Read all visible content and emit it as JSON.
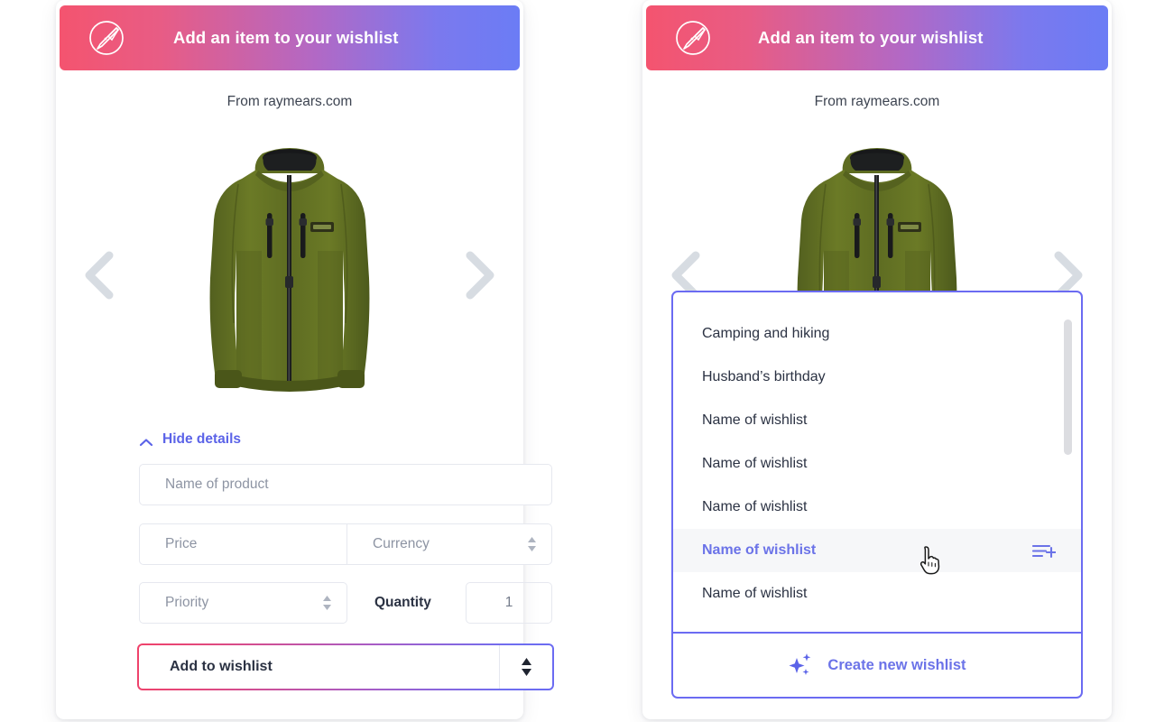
{
  "brand": {
    "gradient_start": "#f4546f",
    "gradient_end": "#6b7cf5",
    "accent_purple": "#6b6bf2",
    "text_dark": "#2b3243",
    "placeholder": "#8d94a3"
  },
  "header": {
    "title": "Add an item to your wishlist",
    "logo_icon": "compass-logo-icon"
  },
  "source": {
    "label": "From raymears.com"
  },
  "carousel": {
    "prev_icon": "chevron-left-icon",
    "next_icon": "chevron-right-icon",
    "product_alt": "olive-green-hooded-fleece-jacket"
  },
  "details": {
    "toggle_label": "Hide details",
    "toggle_icon": "chevron-up-icon",
    "fields": {
      "product_name_placeholder": "Name of product",
      "product_name_value": "",
      "price_placeholder": "Price",
      "price_value": "",
      "currency_placeholder": "Currency",
      "currency_value": "",
      "priority_placeholder": "Priority",
      "priority_value": "",
      "quantity_label": "Quantity",
      "quantity_value": "1"
    }
  },
  "add_select": {
    "label": "Add to wishlist",
    "spinner_icon": "sort-updown-icon"
  },
  "dropdown": {
    "items": [
      {
        "label": "Camping and hiking",
        "hovered": false
      },
      {
        "label": "Husband’s birthday",
        "hovered": false
      },
      {
        "label": "Name of wishlist",
        "hovered": false
      },
      {
        "label": "Name of wishlist",
        "hovered": false
      },
      {
        "label": "Name of wishlist",
        "hovered": false
      },
      {
        "label": "Name of wishlist",
        "hovered": true
      },
      {
        "label": "Name of wishlist",
        "hovered": false
      }
    ],
    "hovered_item_icon": "list-add-icon",
    "scrollbar": "vertical-scrollbar",
    "footer": {
      "label": "Create new wishlist",
      "icon": "sparkles-icon"
    }
  },
  "cursor": {
    "icon": "pointing-hand-cursor"
  }
}
